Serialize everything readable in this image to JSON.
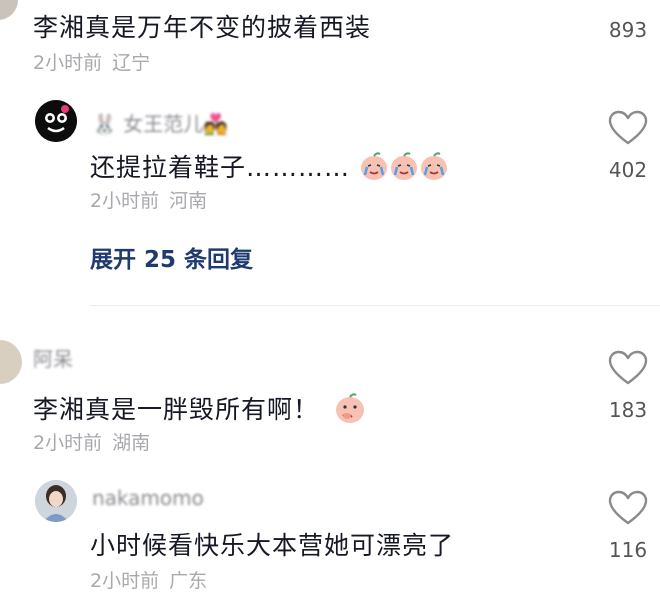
{
  "comments": [
    {
      "text": "李湘真是万年不变的披着西装",
      "time": "2小时前",
      "region": "辽宁",
      "likes": "893",
      "reply": {
        "username": "🐰 女王范儿💑",
        "text": "还提拉着鞋子…………",
        "time": "2小时前",
        "region": "河南",
        "likes": "402"
      },
      "expand_label": "展开 25 条回复"
    },
    {
      "username": "阿呆",
      "text": "李湘真是一胖毁所有啊！",
      "time": "2小时前",
      "region": "湖南",
      "likes": "183",
      "reply": {
        "username": "nakamomo",
        "text": "小时候看快乐大本营她可漂亮了",
        "time": "2小时前",
        "region": "广东",
        "likes": "116"
      }
    }
  ],
  "icons": {
    "like": "heart-outline-icon",
    "emoji_cry": "crying-peach-emoji",
    "emoji_thinking": "thinking-peach-emoji"
  },
  "colors": {
    "text": "#161823",
    "meta": "#a8a9ad",
    "expand": "#1f3a6e",
    "icon": "#8a8a8a"
  }
}
